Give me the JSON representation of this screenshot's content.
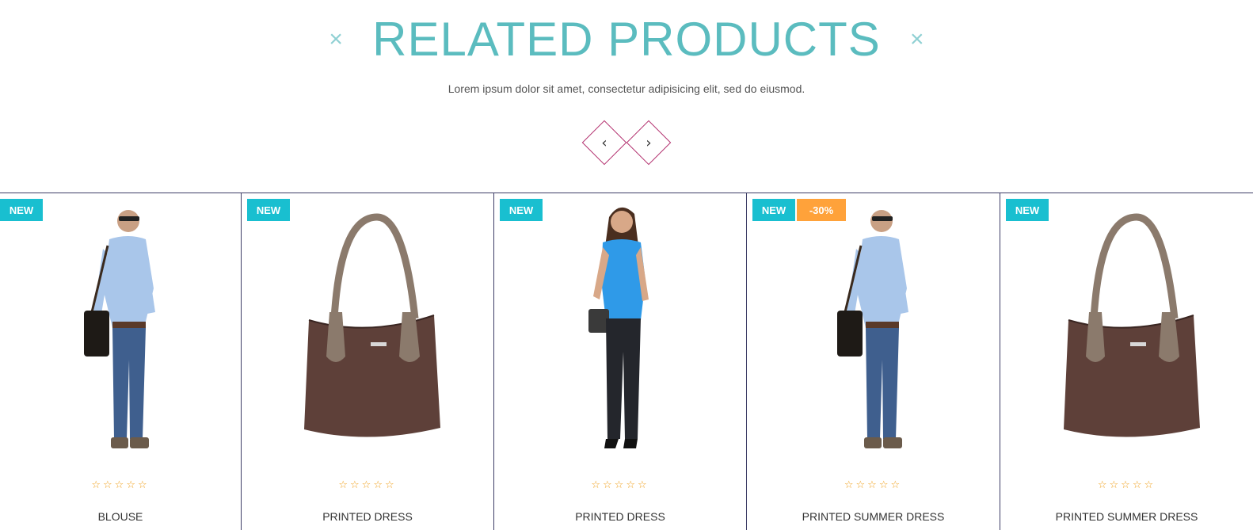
{
  "section": {
    "title": "RELATED PRODUCTS",
    "title_marks": [
      "×",
      "×"
    ],
    "subtitle": "Lorem ipsum dolor sit amet, consectetur adipisicing elit, sed do eiusmod.",
    "nav": {
      "prev_glyph": "‹",
      "next_glyph": "›"
    }
  },
  "colors": {
    "accent": "#5bbcbf",
    "badge_new": "#19bfd0",
    "badge_sale": "#ffa23a",
    "nav_border": "#b3306e",
    "star": "#f0a21f"
  },
  "products": [
    {
      "name": "BLOUSE",
      "image_icon": "man-with-bag-image",
      "badges": [
        "NEW"
      ],
      "stars": "☆☆☆☆☆"
    },
    {
      "name": "PRINTED DRESS",
      "image_icon": "handbag-image",
      "badges": [
        "NEW"
      ],
      "stars": "☆☆☆☆☆"
    },
    {
      "name": "PRINTED DRESS",
      "image_icon": "woman-blue-top-image",
      "badges": [
        "NEW"
      ],
      "stars": "☆☆☆☆☆"
    },
    {
      "name": "PRINTED SUMMER DRESS",
      "image_icon": "man-with-bag-image",
      "badges": [
        "NEW",
        "-30%"
      ],
      "stars": "☆☆☆☆☆"
    },
    {
      "name": "PRINTED SUMMER DRESS",
      "image_icon": "handbag-image",
      "badges": [
        "NEW"
      ],
      "stars": "☆☆☆☆☆"
    }
  ]
}
